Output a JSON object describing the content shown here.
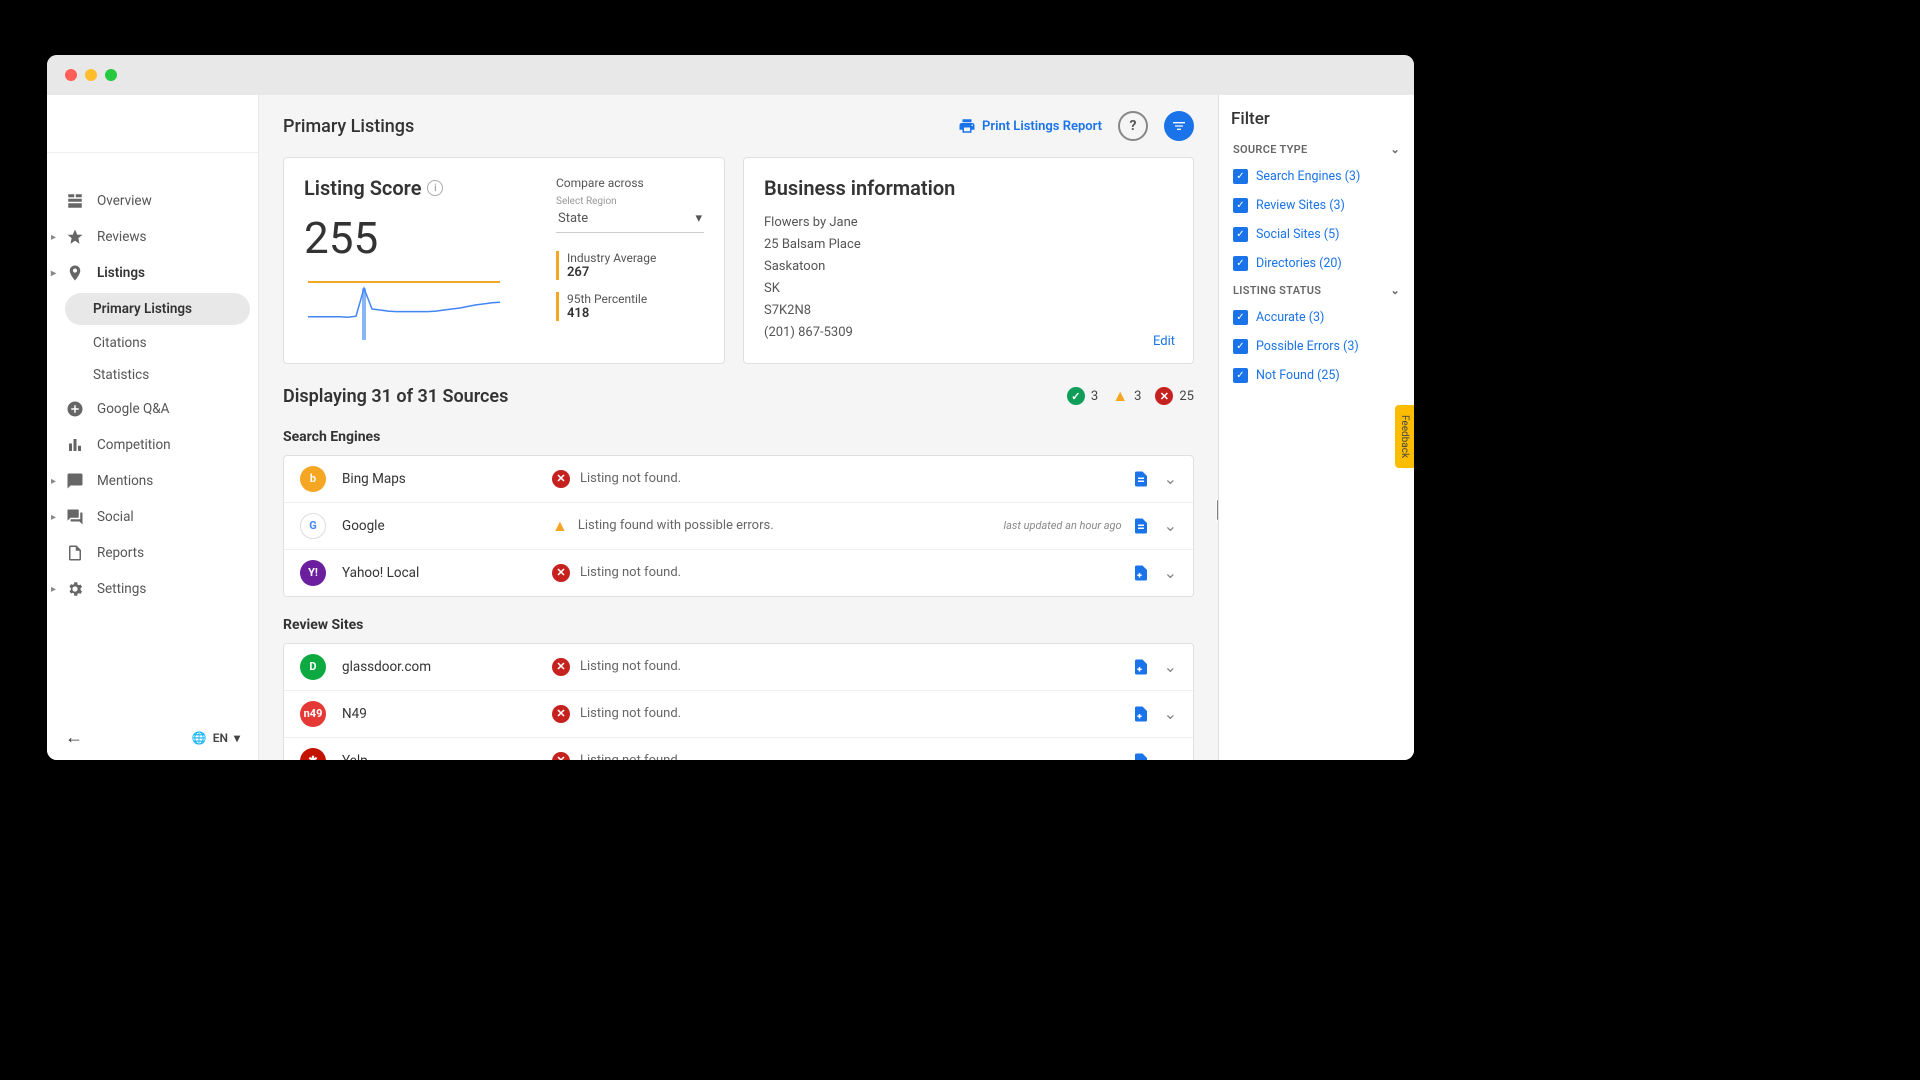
{
  "header": {
    "title": "Primary Listings",
    "print_label": "Print Listings Report"
  },
  "sidebar": {
    "items": [
      {
        "label": "Overview",
        "icon": "dashboard"
      },
      {
        "label": "Reviews",
        "icon": "star",
        "caret": true
      },
      {
        "label": "Listings",
        "icon": "pin",
        "caret": true,
        "active": true
      },
      {
        "label": "Primary Listings",
        "indent": true,
        "active_sub": true
      },
      {
        "label": "Citations",
        "indent": true
      },
      {
        "label": "Statistics",
        "indent": true
      },
      {
        "label": "Google Q&A",
        "icon": "google"
      },
      {
        "label": "Competition",
        "icon": "bars"
      },
      {
        "label": "Mentions",
        "icon": "chat",
        "caret": true
      },
      {
        "label": "Social",
        "icon": "forum",
        "caret": true
      },
      {
        "label": "Reports",
        "icon": "doc"
      },
      {
        "label": "Settings",
        "icon": "gear",
        "caret": true
      }
    ],
    "lang": "EN"
  },
  "score_card": {
    "title": "Listing Score",
    "value": "255",
    "compare_label": "Compare across",
    "select_region_label": "Select Region",
    "region_value": "State",
    "industry_avg_label": "Industry Average",
    "industry_avg_value": "267",
    "percentile_label": "95th Percentile",
    "percentile_value": "418"
  },
  "biz_card": {
    "title": "Business information",
    "name": "Flowers by Jane",
    "address": "25 Balsam Place",
    "city": "Saskatoon",
    "state": "SK",
    "postal": "S7K2N8",
    "phone": "(201) 867-5309",
    "edit_label": "Edit"
  },
  "summary": {
    "title": "Displaying 31 of 31 Sources",
    "ok_count": "3",
    "warn_count": "3",
    "err_count": "25"
  },
  "sections": [
    {
      "title": "Search Engines",
      "rows": [
        {
          "name": "Bing Maps",
          "status": "err",
          "msg": "Listing not found.",
          "logo_bg": "#f5a623",
          "logo_txt": "b",
          "doc": "doc"
        },
        {
          "name": "Google",
          "status": "warn",
          "msg": "Listing found with possible errors.",
          "meta": "last updated an hour ago",
          "logo_bg": "#fff",
          "logo_txt": "G",
          "logo_color": "multi",
          "doc": "doc"
        },
        {
          "name": "Yahoo! Local",
          "status": "err",
          "msg": "Listing not found.",
          "logo_bg": "#6b1f9e",
          "logo_txt": "Y!",
          "doc": "add"
        }
      ]
    },
    {
      "title": "Review Sites",
      "rows": [
        {
          "name": "glassdoor.com",
          "status": "err",
          "msg": "Listing not found.",
          "logo_bg": "#0caa41",
          "logo_txt": "D",
          "doc": "add"
        },
        {
          "name": "N49",
          "status": "err",
          "msg": "Listing not found.",
          "logo_bg": "#e53935",
          "logo_txt": "n49",
          "doc": "add"
        },
        {
          "name": "Yelp",
          "status": "err",
          "msg": "Listing not found.",
          "logo_bg": "#c41200",
          "logo_txt": "✱",
          "doc": "add"
        }
      ]
    }
  ],
  "filter": {
    "title": "Filter",
    "source_type_label": "SOURCE TYPE",
    "listing_status_label": "LISTING STATUS",
    "source_type": [
      {
        "label": "Search Engines (3)"
      },
      {
        "label": "Review Sites (3)"
      },
      {
        "label": "Social Sites (5)"
      },
      {
        "label": "Directories (20)"
      }
    ],
    "listing_status": [
      {
        "label": "Accurate (3)"
      },
      {
        "label": "Possible Errors (3)"
      },
      {
        "label": "Not Found (25)"
      }
    ],
    "feedback_label": "Feedback"
  },
  "chart_data": {
    "type": "line",
    "values": [
      245,
      245,
      245,
      245,
      245,
      244,
      246,
      300,
      260,
      258,
      256,
      255,
      255,
      255,
      255,
      255,
      256,
      258,
      260,
      262,
      265,
      268,
      270,
      272,
      273
    ],
    "ylim": [
      200,
      320
    ],
    "bar_index": 7,
    "bar_value": 300
  }
}
